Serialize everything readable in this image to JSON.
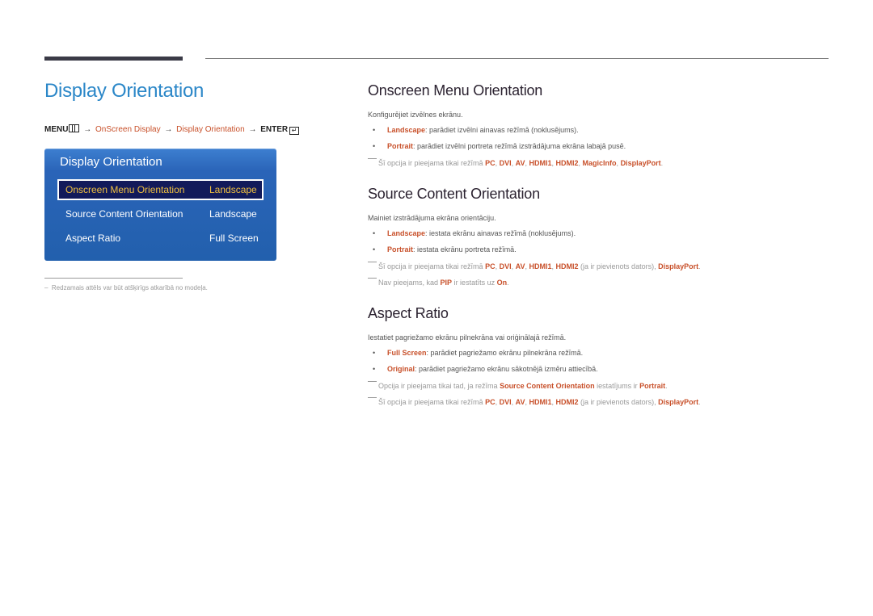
{
  "page": {
    "title": "Display Orientation",
    "menu_path": {
      "menu": "MENU",
      "arrow": "→",
      "step1": "OnScreen Display",
      "step2": "Display Orientation",
      "enter": "ENTER"
    },
    "footnote": "Redzamais attēls var būt atšķirīgs atkarībā no modeļa."
  },
  "osd": {
    "title": "Display Orientation",
    "rows": [
      {
        "label": "Onscreen Menu Orientation",
        "value": "Landscape",
        "selected": true
      },
      {
        "label": "Source Content Orientation",
        "value": "Landscape",
        "selected": false
      },
      {
        "label": "Aspect Ratio",
        "value": "Full Screen",
        "selected": false
      }
    ],
    "colors": {
      "panel": "#2260ad",
      "selected_bg": "#121a5a",
      "selected_text": "#f0c040"
    }
  },
  "sections": {
    "onscreen": {
      "title": "Onscreen Menu Orientation",
      "desc": "Konfigurējiet izvēlnes ekrānu.",
      "bullets": [
        {
          "term": "Landscape",
          "text": ": parādiet izvēlni ainavas režīmā (noklusējums)."
        },
        {
          "term": "Portrait",
          "text": ": parādiet izvēlni portreta režīmā izstrādājuma ekrāna labajā pusē."
        }
      ],
      "note": {
        "prefix": "Šī opcija ir pieejama tikai režīmā ",
        "terms": [
          "PC",
          "DVI",
          "AV",
          "HDMI1",
          "HDMI2",
          "MagicInfo",
          "DisplayPort"
        ]
      }
    },
    "source": {
      "title": "Source Content Orientation",
      "desc": "Mainiet izstrādājuma ekrāna orientāciju.",
      "bullets": [
        {
          "term": "Landscape",
          "text": ": iestata ekrānu ainavas režīmā (noklusējums)."
        },
        {
          "term": "Portrait",
          "text": ": iestata ekrānu portreta režīmā."
        }
      ],
      "note1": {
        "prefix": "Šī opcija ir pieejama tikai režīmā ",
        "t1": "PC",
        "t2": "DVI",
        "t3": "AV",
        "t4": "HDMI1",
        "t5": "HDMI2",
        "mid": " (ja ir pievienots dators), ",
        "t6": "DisplayPort"
      },
      "note2": {
        "prefix": "Nav pieejams, kad ",
        "t1": "PIP",
        "mid": " ir iestatīts uz ",
        "t2": "On"
      }
    },
    "aspect": {
      "title": "Aspect Ratio",
      "desc": "Iestatiet pagriežamo ekrānu pilnekrāna vai oriģinālajā režīmā.",
      "bullets": [
        {
          "term": "Full Screen",
          "text": ": parādiet pagriežamo ekrānu pilnekrāna režīmā."
        },
        {
          "term": "Original",
          "text": ": parādiet pagriežamo ekrānu sākotnējā izmēru attiecībā."
        }
      ],
      "note1": {
        "prefix": "Opcija ir pieejama tikai tad, ja režīma ",
        "t1": "Source Content Orientation",
        "mid": " iestatījums ir ",
        "t2": "Portrait"
      },
      "note2": {
        "prefix": "Šī opcija ir pieejama tikai režīmā ",
        "t1": "PC",
        "t2": "DVI",
        "t3": "AV",
        "t4": "HDMI1",
        "t5": "HDMI2",
        "mid": " (ja ir pievienots dators), ",
        "t6": "DisplayPort"
      }
    }
  },
  "colors": {
    "title_blue": "#2b87c8",
    "accent_orange": "#c8502a",
    "heading_dark": "#2b2230"
  }
}
